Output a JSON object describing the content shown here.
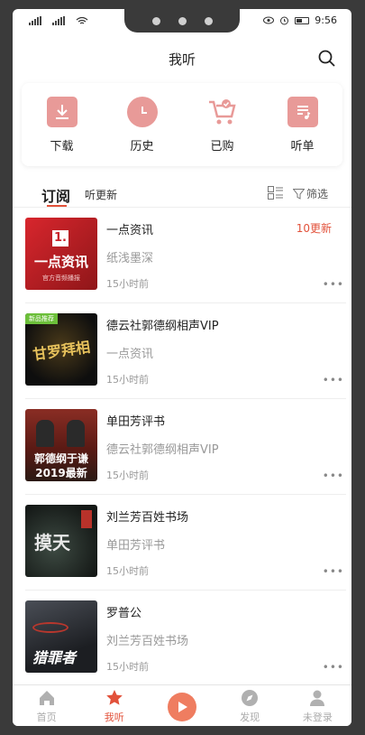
{
  "status": {
    "time": "9:56"
  },
  "header": {
    "title": "我听"
  },
  "quick": [
    {
      "label": "下载",
      "icon": "download-icon"
    },
    {
      "label": "历史",
      "icon": "clock-icon"
    },
    {
      "label": "已购",
      "icon": "cart-icon"
    },
    {
      "label": "听单",
      "icon": "playlist-icon"
    }
  ],
  "tabs": {
    "subscribe": "订阅",
    "updates": "听更新",
    "filter": "筛选"
  },
  "items": [
    {
      "title": "一点资讯",
      "subtitle": "纸浅墨深",
      "time": "15小时前",
      "badge": "10更新",
      "cover_text": "一点资讯",
      "cover_caption": "官方音频播报",
      "cover_color": "#c8242b"
    },
    {
      "title": "德云社郭德纲相声VIP",
      "subtitle": "一点资讯",
      "time": "15小时前",
      "badge": "",
      "cover_text": "甘罗拜相",
      "cover_caption": "新品推荐",
      "cover_color": "#1a1a1a"
    },
    {
      "title": "单田芳评书",
      "subtitle": "德云社郭德纲相声VIP",
      "time": "15小时前",
      "badge": "",
      "cover_text": "郭德纲于谦",
      "cover_caption": "2019最新",
      "cover_color": "#6b2a22"
    },
    {
      "title": "刘兰芳百姓书场",
      "subtitle": "单田芳评书",
      "time": "15小时前",
      "badge": "",
      "cover_text": "摸天",
      "cover_caption": "",
      "cover_color": "#1e2522"
    },
    {
      "title": "罗普公",
      "subtitle": "刘兰芳百姓书场",
      "time": "15小时前",
      "badge": "",
      "cover_text": "猎罪者",
      "cover_caption": "",
      "cover_color": "#2a2d33"
    }
  ],
  "bottom": [
    {
      "label": "首页",
      "active": false
    },
    {
      "label": "我听",
      "active": true
    },
    {
      "label": "",
      "active": false
    },
    {
      "label": "发现",
      "active": false
    },
    {
      "label": "未登录",
      "active": false
    }
  ],
  "colors": {
    "accent": "#e2513a",
    "icon_pink": "#e89a98"
  }
}
